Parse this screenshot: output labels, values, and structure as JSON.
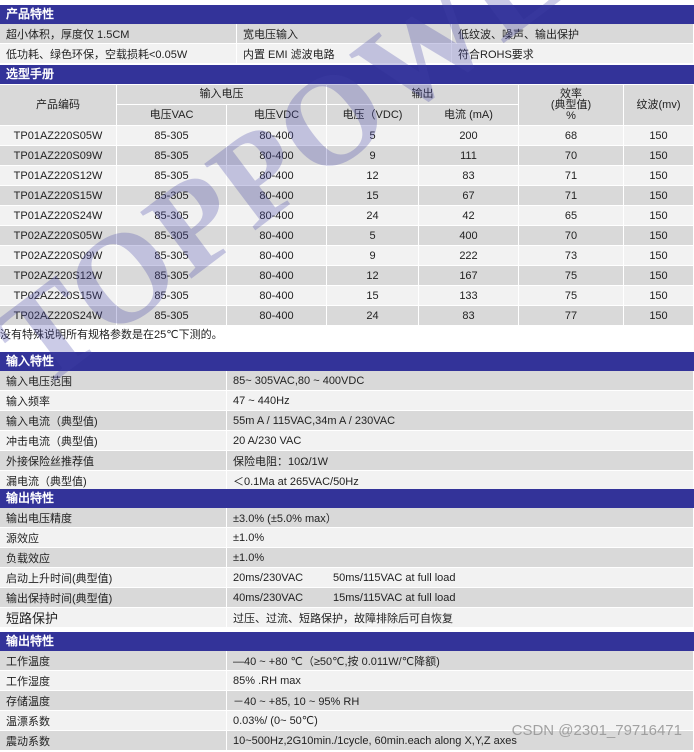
{
  "features": {
    "title": "产品特性",
    "rows": [
      [
        "超小体积，厚度仅 1.5CM",
        "宽电压输入",
        "低纹波、噪声、输出保护"
      ],
      [
        "低功耗、绿色环保，空载损耗<0.05W",
        "内置 EMI 滤波电路",
        "符合ROHS要求"
      ]
    ]
  },
  "selection": {
    "title": "选型手册",
    "headers": {
      "code": "产品编码",
      "input": "输入电压",
      "vac": "电压VAC",
      "vdc": "电压VDC",
      "output": "输出",
      "vout": "电压（VDC)",
      "iout": "电流 (mA)",
      "eff": "效率\n(典型值)\n%",
      "ripple": "纹波(mv)"
    },
    "rows": [
      [
        "TP01AZ220S05W",
        "85-305",
        "80-400",
        "5",
        "200",
        "68",
        "150"
      ],
      [
        "TP01AZ220S09W",
        "85-305",
        "80-400",
        "9",
        "111",
        "70",
        "150"
      ],
      [
        "TP01AZ220S12W",
        "85-305",
        "80-400",
        "12",
        "83",
        "71",
        "150"
      ],
      [
        "TP01AZ220S15W",
        "85-305",
        "80-400",
        "15",
        "67",
        "71",
        "150"
      ],
      [
        "TP01AZ220S24W",
        "85-305",
        "80-400",
        "24",
        "42",
        "65",
        "150"
      ],
      [
        "TP02AZ220S05W",
        "85-305",
        "80-400",
        "5",
        "400",
        "70",
        "150"
      ],
      [
        "TP02AZ220S09W",
        "85-305",
        "80-400",
        "9",
        "222",
        "73",
        "150"
      ],
      [
        "TP02AZ220S12W",
        "85-305",
        "80-400",
        "12",
        "167",
        "75",
        "150"
      ],
      [
        "TP02AZ220S15W",
        "85-305",
        "80-400",
        "15",
        "133",
        "75",
        "150"
      ],
      [
        "TP02AZ220S24W",
        "85-305",
        "80-400",
        "24",
        "83",
        "77",
        "150"
      ]
    ],
    "note": "没有特殊说明所有规格参数是在25℃下测的。"
  },
  "input_specs": {
    "title": "输入特性",
    "rows": [
      [
        "输入电压范围",
        "85~ 305VAC,80 ~ 400VDC"
      ],
      [
        "输入频率",
        "47 ~ 440Hz"
      ],
      [
        "输入电流（典型值)",
        "55m A / 115VAC,34m A / 230VAC"
      ],
      [
        "冲击电流（典型值)",
        "20 A/230 VAC"
      ],
      [
        "外接保险丝推荐值",
        "保险电阻：10Ω/1W"
      ],
      [
        "漏电流（典型值)",
        "＜0.1Ma at 265VAC/50Hz"
      ]
    ]
  },
  "output_specs": {
    "title": "输出特性",
    "rows": [
      [
        "输出电压精度",
        "±3.0% (±5.0% max）"
      ],
      [
        "源效应",
        "±1.0%"
      ],
      [
        "负载效应",
        "±1.0%"
      ],
      [
        "启动上升时间(典型值)",
        "20ms/230VAC",
        "50ms/115VAC at full load"
      ],
      [
        "输出保持时间(典型值)",
        "40ms/230VAC",
        "15ms/115VAC at full load"
      ],
      [
        "短路保护",
        "过压、过流、短路保护，故障排除后可自恢复"
      ]
    ]
  },
  "env_specs": {
    "title": "输出特性",
    "rows": [
      [
        "工作温度",
        "—40 ~ +80  ℃（≥50℃,按 0.011W/℃降额)"
      ],
      [
        "工作湿度",
        "85% .RH max"
      ],
      [
        "存储温度",
        "－40 ~ +85, 10 ~ 95% RH"
      ],
      [
        "温漂系数",
        "0.03%/ (0~ 50℃)"
      ],
      [
        "震动系数",
        "10~500Hz,2G10min./1cycle, 60min.each along X,Y,Z axes"
      ]
    ]
  },
  "watermark": "TOPPOWER",
  "credit": "CSDN @2301_79716471",
  "colors": {
    "section_header": "#333399",
    "row_gray": "#d9d9d9",
    "row_light": "#f2f2f2"
  }
}
